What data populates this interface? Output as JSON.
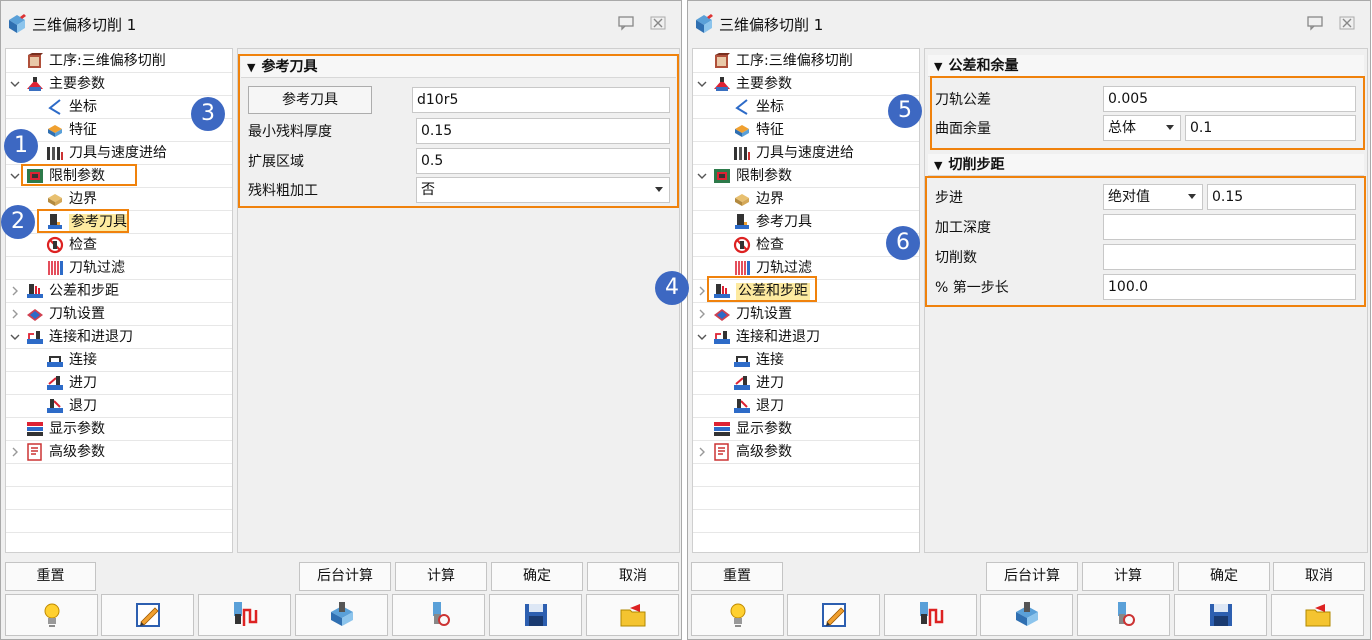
{
  "title": "三维偏移切削 1",
  "tree": [
    {
      "label": "工序:三维偏移切削",
      "icon": "operation-book-icon",
      "indent": 0,
      "twisty": "none"
    },
    {
      "label": "主要参数",
      "icon": "main-params-icon",
      "indent": 0,
      "twisty": "expanded"
    },
    {
      "label": "坐标",
      "icon": "coordinate-icon",
      "indent": 1,
      "twisty": "none"
    },
    {
      "label": "特征",
      "icon": "feature-icon",
      "indent": 1,
      "twisty": "none"
    },
    {
      "label": "刀具与速度进给",
      "icon": "tool-speed-icon",
      "indent": 1,
      "twisty": "none"
    },
    {
      "label": "限制参数",
      "icon": "limit-params-icon",
      "indent": 0,
      "twisty": "expanded"
    },
    {
      "label": "边界",
      "icon": "boundary-icon",
      "indent": 1,
      "twisty": "none"
    },
    {
      "label": "参考刀具",
      "icon": "reference-tool-icon",
      "indent": 1,
      "twisty": "none"
    },
    {
      "label": "检查",
      "icon": "check-icon",
      "indent": 1,
      "twisty": "none"
    },
    {
      "label": "刀轨过滤",
      "icon": "toolpath-filter-icon",
      "indent": 1,
      "twisty": "none"
    },
    {
      "label": "公差和步距",
      "icon": "tolerance-stepover-icon",
      "indent": 0,
      "twisty": "collapsed"
    },
    {
      "label": "刀轨设置",
      "icon": "toolpath-settings-icon",
      "indent": 0,
      "twisty": "collapsed"
    },
    {
      "label": "连接和进退刀",
      "icon": "link-leadin-icon",
      "indent": 0,
      "twisty": "expanded"
    },
    {
      "label": "连接",
      "icon": "link-icon",
      "indent": 1,
      "twisty": "none"
    },
    {
      "label": "进刀",
      "icon": "lead-in-icon",
      "indent": 1,
      "twisty": "none"
    },
    {
      "label": "退刀",
      "icon": "lead-out-icon",
      "indent": 1,
      "twisty": "none"
    },
    {
      "label": "显示参数",
      "icon": "display-params-icon",
      "indent": 0,
      "twisty": "none"
    },
    {
      "label": "高级参数",
      "icon": "advanced-params-icon",
      "indent": 0,
      "twisty": "collapsed"
    }
  ],
  "left": {
    "selected_item": "参考刀具",
    "section": {
      "title": "参考刀具",
      "ref_tool_button": "参考刀具",
      "ref_tool_value": "d10r5",
      "min_stock_label": "最小残料厚度",
      "min_stock_value": "0.15",
      "extend_label": "扩展区域",
      "extend_value": "0.5",
      "rough_label": "残料粗加工",
      "rough_value": "否"
    }
  },
  "right": {
    "selected_item": "公差和步距",
    "tolerance": {
      "title": "公差和余量",
      "tp_tol_label": "刀轨公差",
      "tp_tol_value": "0.005",
      "surf_stock_label": "曲面余量",
      "surf_stock_mode": "总体",
      "surf_stock_value": "0.1"
    },
    "stepover": {
      "title": "切削步距",
      "step_label": "步进",
      "step_mode": "绝对值",
      "step_value": "0.15",
      "depth_label": "加工深度",
      "depth_value": "",
      "count_label": "切削数",
      "count_value": "",
      "first_step_label": "% 第一步长",
      "first_step_value": "100.0"
    }
  },
  "buttons": {
    "reset": "重置",
    "background_calc": "后台计算",
    "calc": "计算",
    "ok": "确定",
    "cancel": "取消"
  },
  "icon_buttons": [
    "lightbulb-icon",
    "edit-pencil-icon",
    "tool-path-icon",
    "solid-model-icon",
    "tool-check-icon",
    "save-disk-icon",
    "undo-folder-icon"
  ],
  "badges": {
    "b1": "1",
    "b2": "2",
    "b3": "3",
    "b4": "4",
    "b5": "5",
    "b6": "6"
  },
  "colors": {
    "highlight": "#f0820c",
    "badge": "#3d68c2",
    "selected_bg": "#fdeaa0"
  }
}
